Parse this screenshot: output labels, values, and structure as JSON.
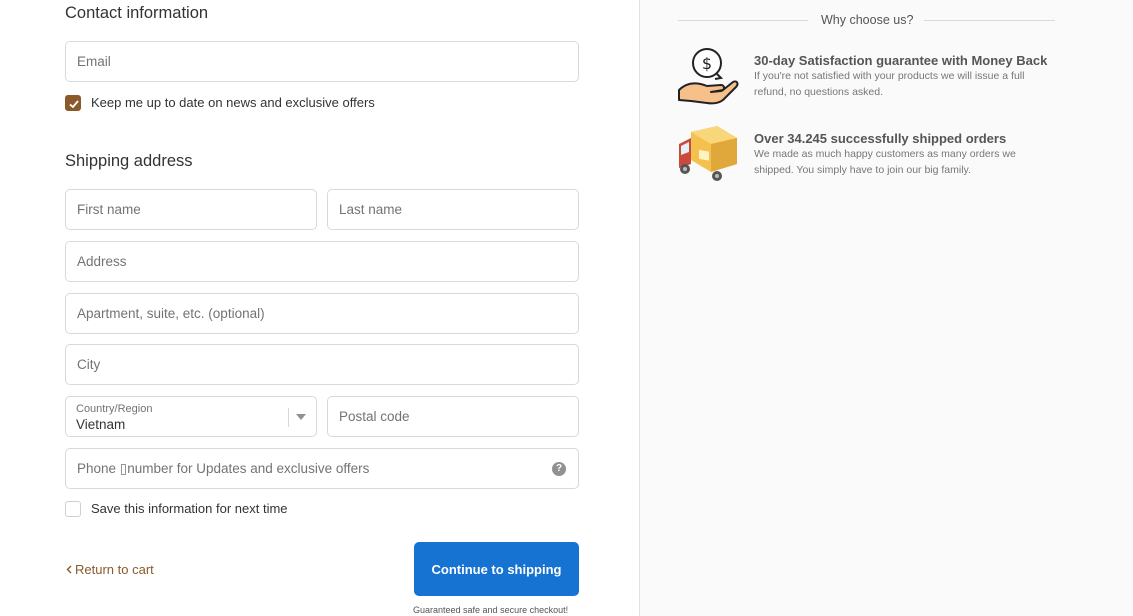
{
  "contact": {
    "heading": "Contact information",
    "email_placeholder": "Email",
    "newsletter_label": "Keep me up to date on news and exclusive offers",
    "newsletter_checked": true
  },
  "shipping": {
    "heading": "Shipping address",
    "first_name_placeholder": "First name",
    "last_name_placeholder": "Last name",
    "address_placeholder": "Address",
    "apartment_placeholder": "Apartment, suite, etc. (optional)",
    "city_placeholder": "City",
    "country_label": "Country/Region",
    "country_value": "Vietnam",
    "postal_placeholder": "Postal code",
    "phone_placeholder": "Phone ▯number for Updates and exclusive offers",
    "phone_help_glyph": "?",
    "save_info_label": "Save this information for next time",
    "save_info_checked": false
  },
  "actions": {
    "return_label": "Return to cart",
    "continue_label": "Continue to shipping",
    "secure_note": "Guaranteed safe and secure checkout!"
  },
  "sidebar": {
    "heading": "Why choose us?",
    "features": [
      {
        "icon": "money-back-icon",
        "title": "30-day Satisfaction guarantee with Money Back",
        "text": "If you're not satisfied with your products we will issue a full refund, no questions asked."
      },
      {
        "icon": "delivery-truck-icon",
        "title": "Over 34.245 successfully shipped orders",
        "text": "We made as much happy customers as many orders we shipped. You simply have to join our big family."
      }
    ]
  },
  "colors": {
    "accent": "#8b5a2b",
    "button": "#1773d1",
    "sidebar_bg": "#fafafa"
  }
}
